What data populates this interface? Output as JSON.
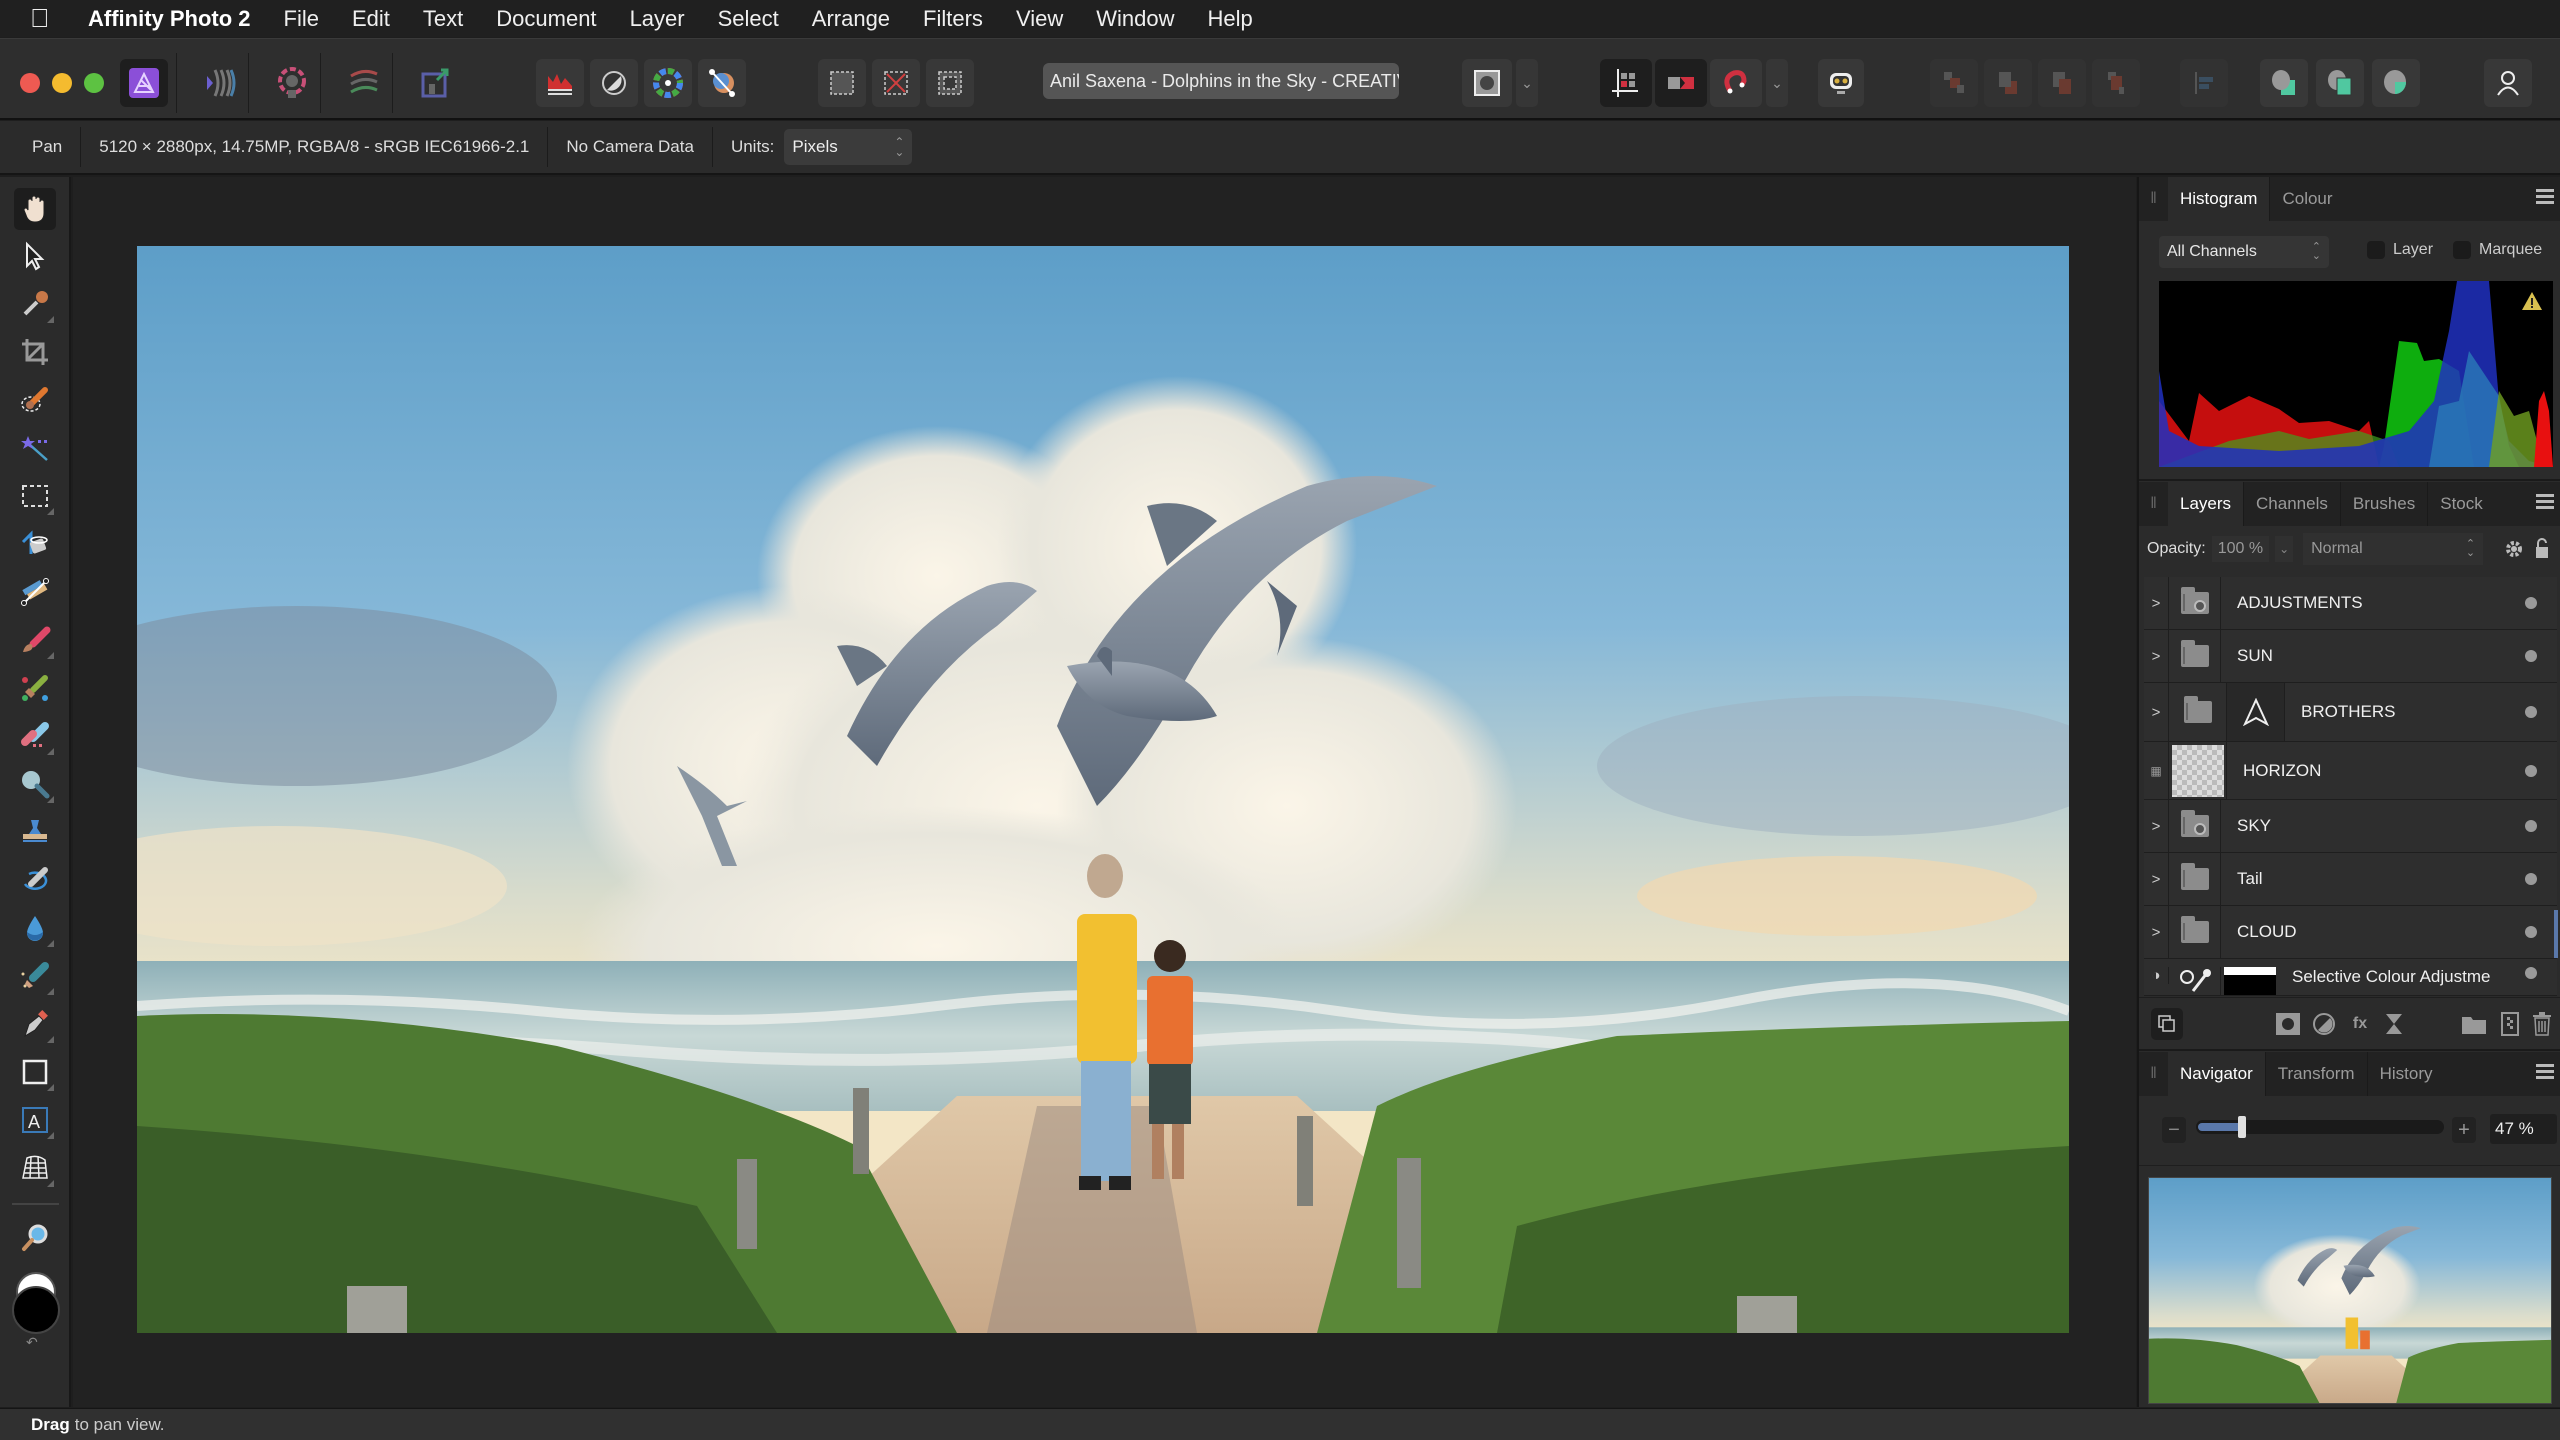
{
  "menubar": {
    "app_name": "Affinity Photo 2",
    "items": [
      "File",
      "Edit",
      "Text",
      "Document",
      "Layer",
      "Select",
      "Arrange",
      "Filters",
      "View",
      "Window",
      "Help"
    ]
  },
  "toolbar": {
    "personas": [
      "photo-persona",
      "liquify-persona",
      "develop-persona",
      "tone-mapping-persona",
      "export-persona"
    ],
    "document_title": "Anil Saxena - Dolphins in the Sky - CREATIVI",
    "quick_actions": [
      "levels",
      "brightness-contrast",
      "hsl",
      "curves"
    ],
    "selection_actions": [
      "select-all",
      "deselect",
      "invert-selection"
    ],
    "snapping": [
      "snapping-grid",
      "assistant",
      "snapping-magnet",
      "assistant-options"
    ],
    "arrange": [
      "move-to-back",
      "move-back-one",
      "move-forward-one",
      "move-to-front"
    ],
    "boolean": [
      "add",
      "subtract",
      "intersect"
    ],
    "account": "account-icon"
  },
  "contextbar": {
    "tool_name": "Pan",
    "document_info": "5120 × 2880px, 14.75MP, RGBA/8 - sRGB IEC61966-2.1",
    "camera": "No Camera Data",
    "units_label": "Units:",
    "units_value": "Pixels"
  },
  "tools": [
    "view-tool",
    "move-tool",
    "colour-picker-tool",
    "crop-tool",
    "selection-brush-tool",
    "flood-select-tool",
    "marquee-tool",
    "flood-fill-tool",
    "gradient-tool",
    "paint-brush-tool",
    "colour-replacement-tool",
    "erase-brush-tool",
    "dodge-tool",
    "clone-tool",
    "undo-brush-tool",
    "blur-tool",
    "healing-tool",
    "pen-tool",
    "rectangle-tool",
    "artistic-text-tool",
    "mesh-warp-tool",
    "zoom-tool"
  ],
  "status": {
    "bold": "Drag",
    "text": "to pan view."
  },
  "histogram_panel": {
    "tabs": [
      "Histogram",
      "Colour"
    ],
    "active_tab": "Histogram",
    "channel": "All Channels",
    "layer_label": "Layer",
    "marquee_label": "Marquee",
    "warning": true
  },
  "layers_panel": {
    "tabs": [
      "Layers",
      "Channels",
      "Brushes",
      "Stock"
    ],
    "active_tab": "Layers",
    "opacity_label": "Opacity:",
    "opacity_value": "100 %",
    "blend_mode": "Normal",
    "layers": [
      {
        "name": "ADJUSTMENTS",
        "type": "adjustment-group"
      },
      {
        "name": "SUN",
        "type": "group"
      },
      {
        "name": "BROTHERS",
        "type": "group"
      },
      {
        "name": "HORIZON",
        "type": "pixel"
      },
      {
        "name": "SKY",
        "type": "adjustment-group"
      },
      {
        "name": "Tail",
        "type": "group"
      },
      {
        "name": "CLOUD",
        "type": "group"
      },
      {
        "name": "Selective Colour Adjustme",
        "type": "adjustment"
      }
    ]
  },
  "navigator_panel": {
    "tabs": [
      "Navigator",
      "Transform",
      "History"
    ],
    "active_tab": "Navigator",
    "zoom_value": "47 %",
    "zoom_fraction": 0.18
  },
  "colors": {
    "accent": "#5a78aa",
    "menubar": "#202020",
    "panel": "#2b2b2b"
  }
}
